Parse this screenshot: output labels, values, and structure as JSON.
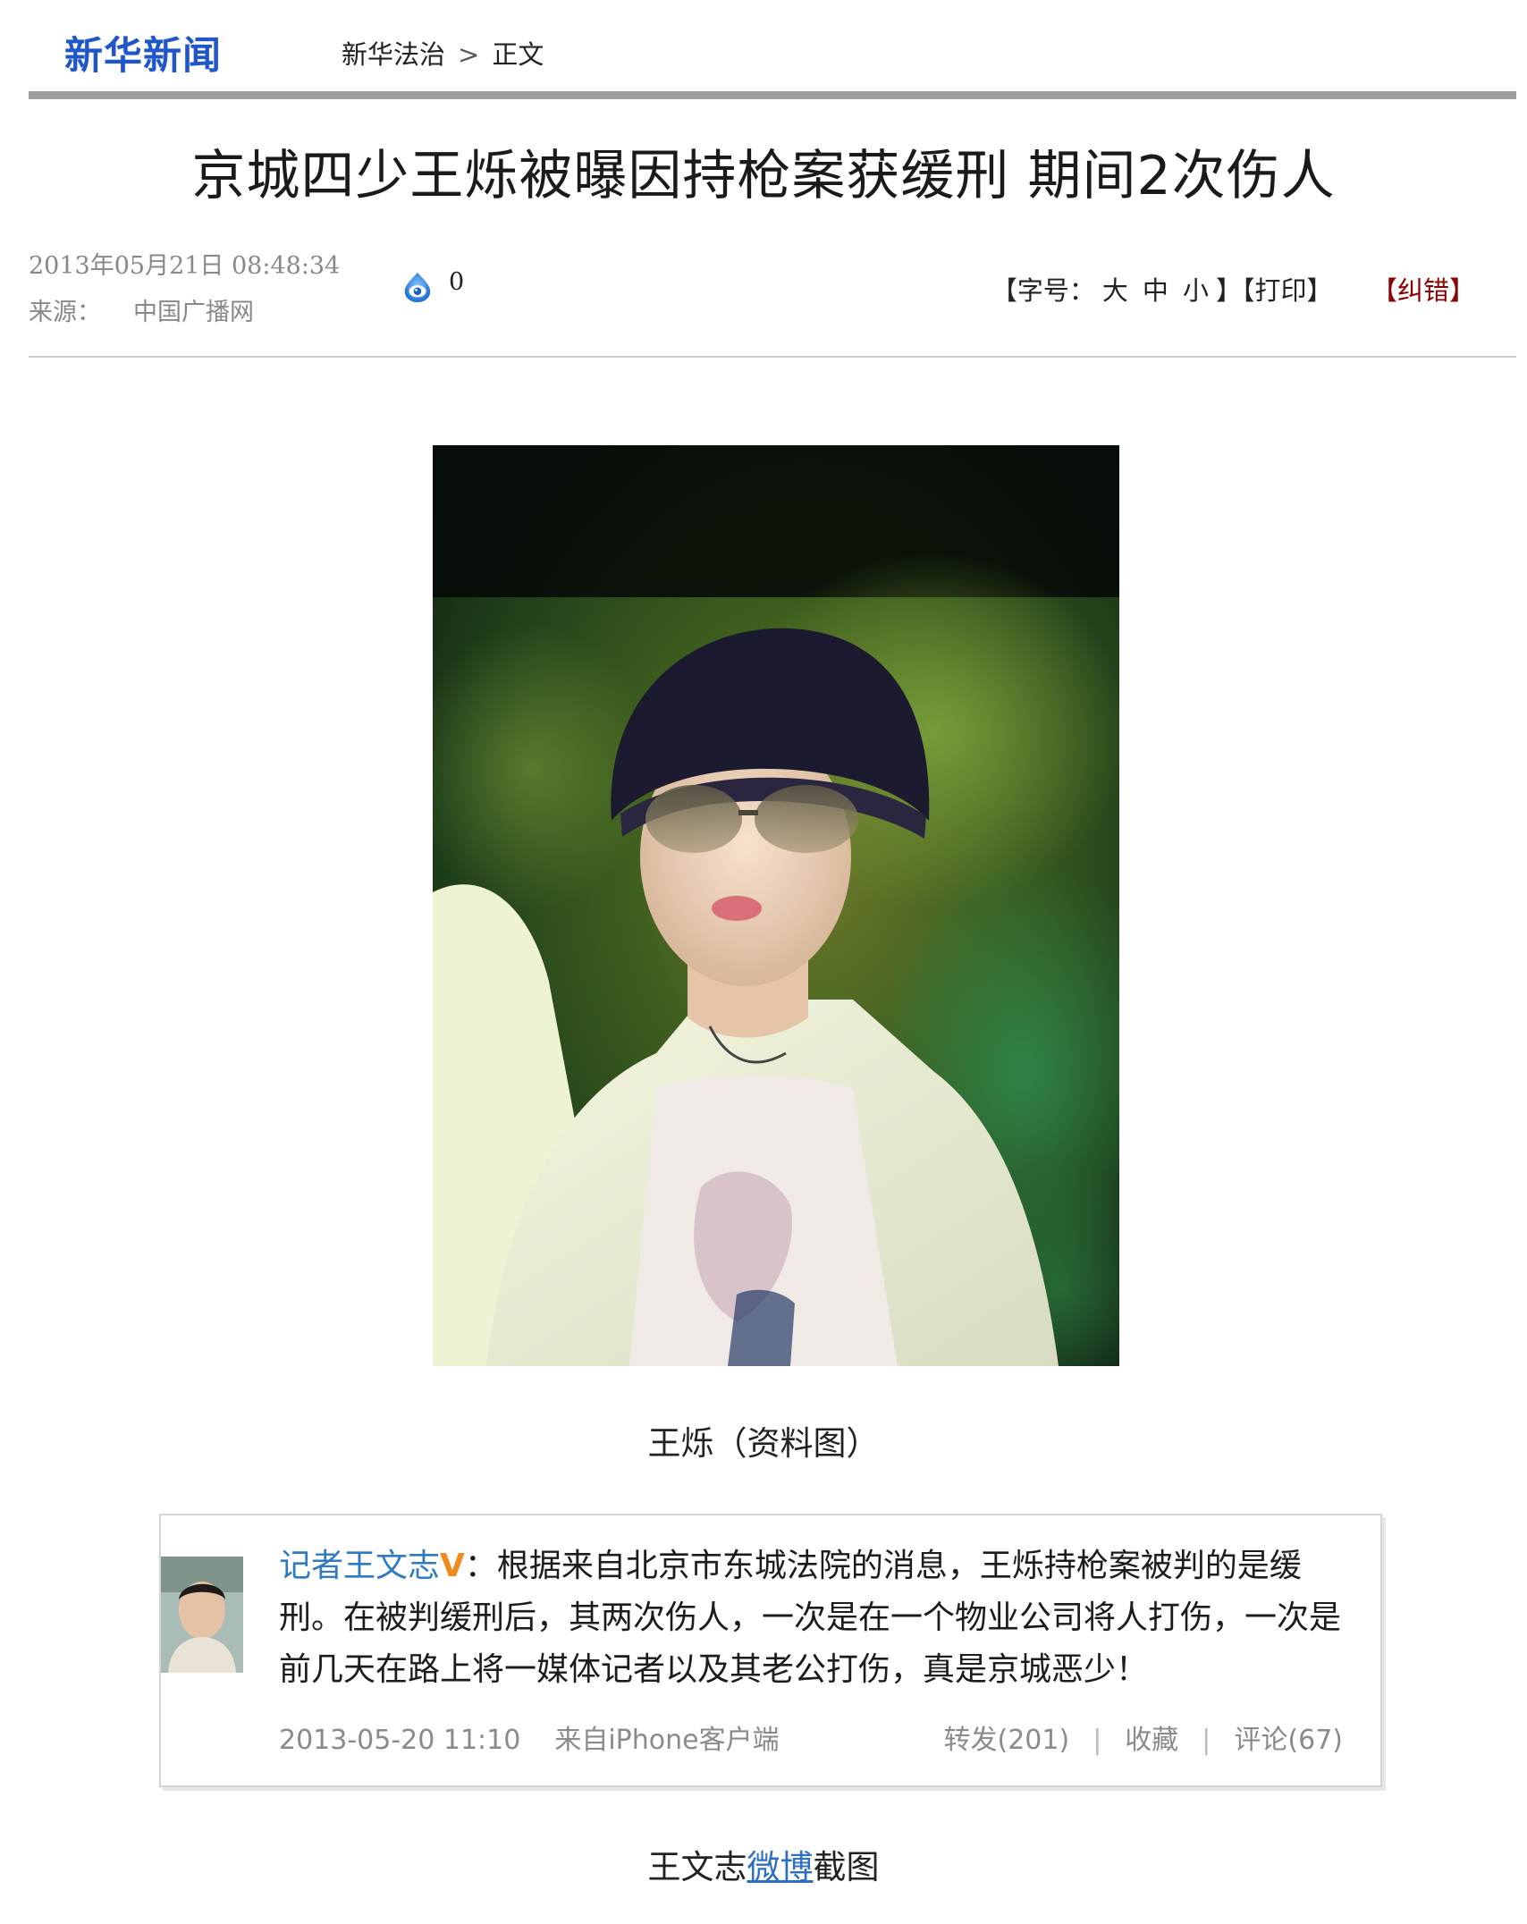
{
  "header": {
    "brand": "新华新闻",
    "breadcrumb": [
      "新华法治",
      "正文"
    ],
    "breadcrumb_sep": ">"
  },
  "article": {
    "title": "京城四少王烁被曝因持枪案获缓刑 期间2次伤人",
    "datetime": "2013年05月21日 08:48:34",
    "source_label": "来源：",
    "source_value": "中国广播网",
    "comment_count": "0"
  },
  "tools": {
    "font_open": "【字号：",
    "font_large": "大",
    "font_medium": "中",
    "font_small": "小",
    "font_close": "】",
    "print": "【打印】",
    "correct": "【纠错】"
  },
  "photo": {
    "caption": "王烁（资料图）"
  },
  "weibo": {
    "author": "记者王文志",
    "badge": "V",
    "text": "：根据来自北京市东城法院的消息，王烁持枪案被判的是缓刑。在被判缓刑后，其两次伤人，一次是在一个物业公司将人打伤，一次是前几天在路上将一媒体记者以及其老公打伤，真是京城恶少！",
    "time": "2013-05-20 11:10",
    "via": "来自iPhone客户端",
    "repost": "转发(201)",
    "favorite": "收藏",
    "comment": "评论(67)",
    "sep": "|"
  },
  "caption2": {
    "prefix": "王文志",
    "link": "微博",
    "suffix": "截图"
  },
  "colors": {
    "brand": "#1f56c8",
    "correct": "#8b0000",
    "weibo_author": "#2e7bc4",
    "weibo_badge": "#f08a1c"
  },
  "icons": {
    "counter": "eye-icon"
  }
}
